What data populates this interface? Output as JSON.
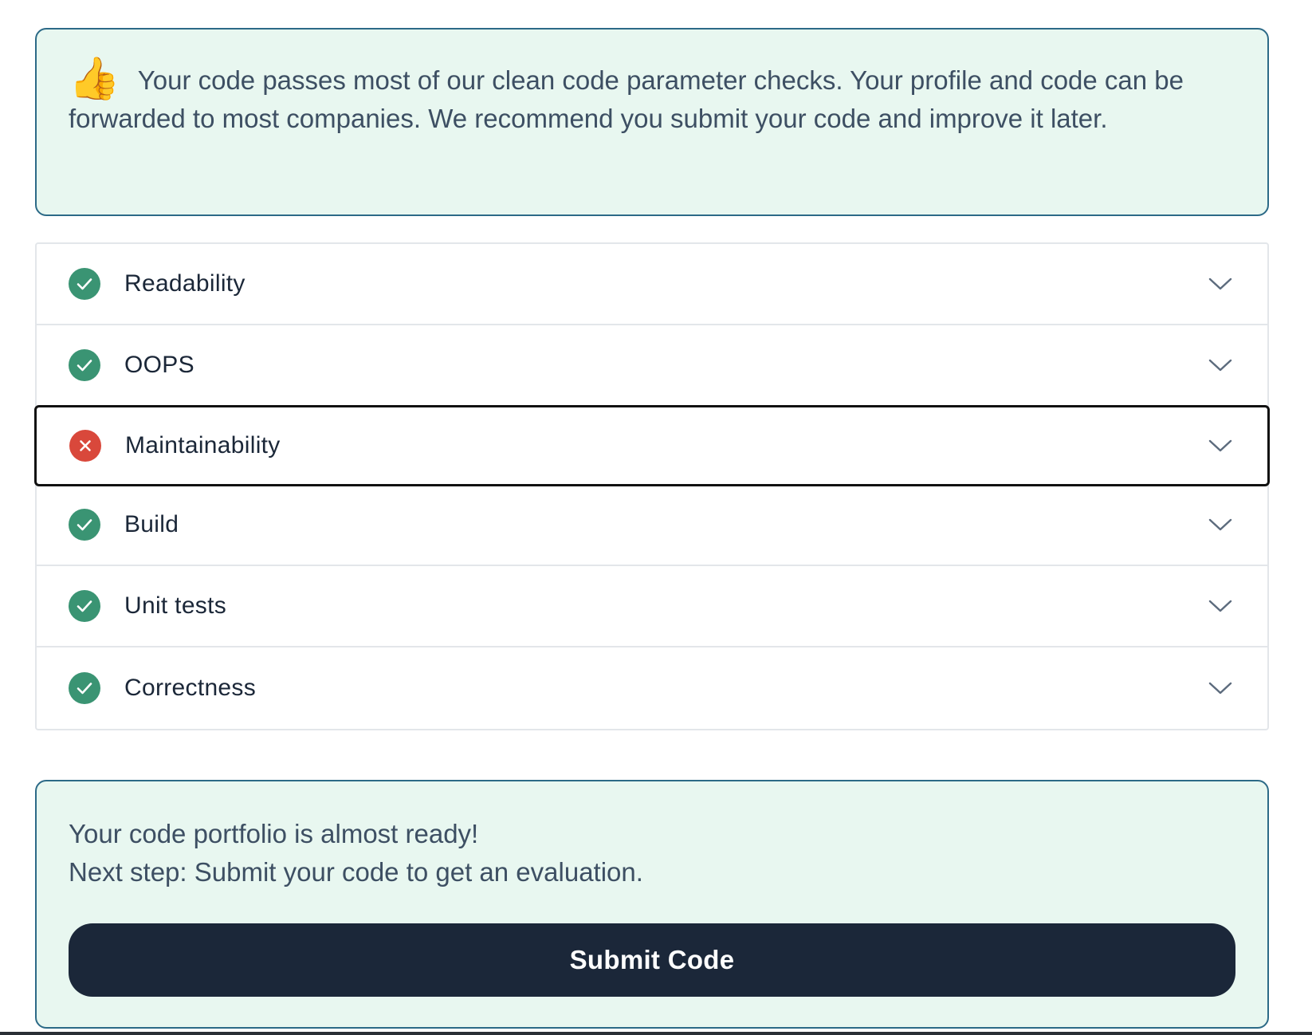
{
  "banner": {
    "icon": "thumbs-up-icon",
    "text": "Your code passes most of our clean code parameter checks. Your profile and code can be forwarded to most companies. We recommend you submit your code and improve it later."
  },
  "checks": {
    "items": [
      {
        "label": "Readability",
        "status": "pass"
      },
      {
        "label": "OOPS",
        "status": "pass"
      },
      {
        "label": "Maintainability",
        "status": "fail"
      },
      {
        "label": "Build",
        "status": "pass"
      },
      {
        "label": "Unit tests",
        "status": "pass"
      },
      {
        "label": "Correctness",
        "status": "pass"
      }
    ]
  },
  "cta": {
    "line1": "Your code portfolio is almost ready!",
    "line2": "Next step: Submit your code to get an evaluation.",
    "submit_label": "Submit Code"
  },
  "colors": {
    "pass": "#3a9473",
    "fail": "#d9483b",
    "banner_bg": "#e8f7f0",
    "banner_border": "#2c6a87",
    "button_bg": "#1b2739"
  }
}
